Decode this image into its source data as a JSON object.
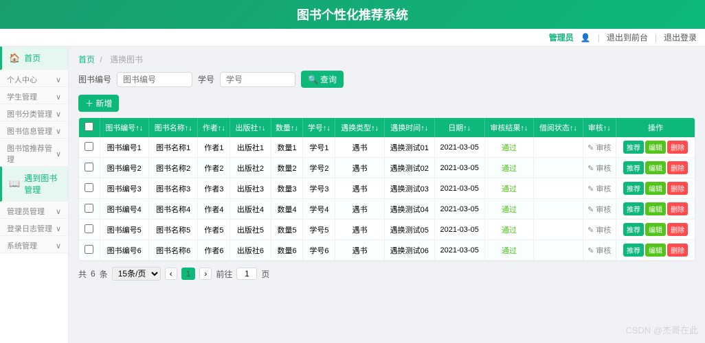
{
  "header": {
    "title": "图书个性化推荐系统"
  },
  "topnav": {
    "admin_label": "管理员",
    "admin_icon": "👤",
    "logout_frontend": "退出到前台",
    "logout": "退出登录"
  },
  "sidebar": {
    "home": "首页",
    "home_icon": "🏠",
    "profile": "个人中心",
    "profile_icon": "👤",
    "student_mgmt": "学生管理",
    "student_icon": "👨‍🎓",
    "book_category": "图书分类管理",
    "book_category_icon": "📂",
    "book_mgmt": "图书信息管理",
    "book_mgmt_icon": "📚",
    "book_recommend": "图书馆推荐管理",
    "book_recommend_icon": "📖",
    "borrow_sub": "遇到图书",
    "borrow_book": "遇到图书管理",
    "borrow_icon": "📖",
    "manager_mgmt": "管理员管理",
    "manager_icon": "👔",
    "log_mgmt": "登录日志管理",
    "log_icon": "📋",
    "sys_mgmt": "系统管理",
    "sys_icon": "⚙️"
  },
  "breadcrumb": {
    "home": "首页",
    "current": "遇换图书"
  },
  "search": {
    "book_num_label": "图书编号",
    "book_num_placeholder": "图书编号",
    "student_num_label": "学号",
    "student_num_placeholder": "学号",
    "search_btn": "查询",
    "add_btn": "＋ 新增"
  },
  "table": {
    "columns": [
      "",
      "图书编号↑↓",
      "图书名称↑↓",
      "作者↑↓",
      "出版社↑↓",
      "数量↑↓",
      "学号↑↓",
      "遇换类型↑↓",
      "遇换时间↑↓",
      "日期↑↓",
      "审核结果↑↓",
      "借阅状态↑↓",
      "审核↑↓",
      "操作"
    ],
    "rows": [
      {
        "book_num": "图书编号1",
        "book_name": "图书名称1",
        "author": "作者1",
        "publisher": "出版社1",
        "count": "数量1",
        "student_num": "学号1",
        "borrow_type": "遇书",
        "borrow_time": "遇换测试01",
        "date": "2021-03-05",
        "review_result": "通过",
        "borrow_status": "",
        "review": ""
      },
      {
        "book_num": "图书编号2",
        "book_name": "图书名称2",
        "author": "作者2",
        "publisher": "出版社2",
        "count": "数量2",
        "student_num": "学号2",
        "borrow_type": "遇书",
        "borrow_time": "遇换测试02",
        "date": "2021-03-05",
        "review_result": "通过",
        "borrow_status": "",
        "review": ""
      },
      {
        "book_num": "图书编号3",
        "book_name": "图书名称3",
        "author": "作者3",
        "publisher": "出版社3",
        "count": "数量3",
        "student_num": "学号3",
        "borrow_type": "遇书",
        "borrow_time": "遇换测试03",
        "date": "2021-03-05",
        "review_result": "通过",
        "borrow_status": "",
        "review": ""
      },
      {
        "book_num": "图书编号4",
        "book_name": "图书名称4",
        "author": "作者4",
        "publisher": "出版社4",
        "count": "数量4",
        "student_num": "学号4",
        "borrow_type": "遇书",
        "borrow_time": "遇换测试04",
        "date": "2021-03-05",
        "review_result": "通过",
        "borrow_status": "",
        "review": ""
      },
      {
        "book_num": "图书编号5",
        "book_name": "图书名称5",
        "author": "作者5",
        "publisher": "出版社5",
        "count": "数量5",
        "student_num": "学号5",
        "borrow_type": "遇书",
        "borrow_time": "遇换测试05",
        "date": "2021-03-05",
        "review_result": "通过",
        "borrow_status": "",
        "review": ""
      },
      {
        "book_num": "图书编号6",
        "book_name": "图书名称6",
        "author": "作者6",
        "publisher": "出版社6",
        "count": "数量6",
        "student_num": "学号6",
        "borrow_type": "遇书",
        "borrow_time": "遇换测试06",
        "date": "2021-03-05",
        "review_result": "通过",
        "borrow_status": "",
        "review": ""
      }
    ],
    "action_recommend": "推荐",
    "action_edit": "编辑",
    "action_delete": "删除"
  },
  "pagination": {
    "total_prefix": "共",
    "total": "6",
    "total_suffix": "条",
    "per_page": "15条/页",
    "prev": "‹",
    "page": "1",
    "next": "›",
    "jump_prefix": "前往",
    "jump_suffix": "页"
  },
  "watermark": "CSDN @杰哥在此"
}
